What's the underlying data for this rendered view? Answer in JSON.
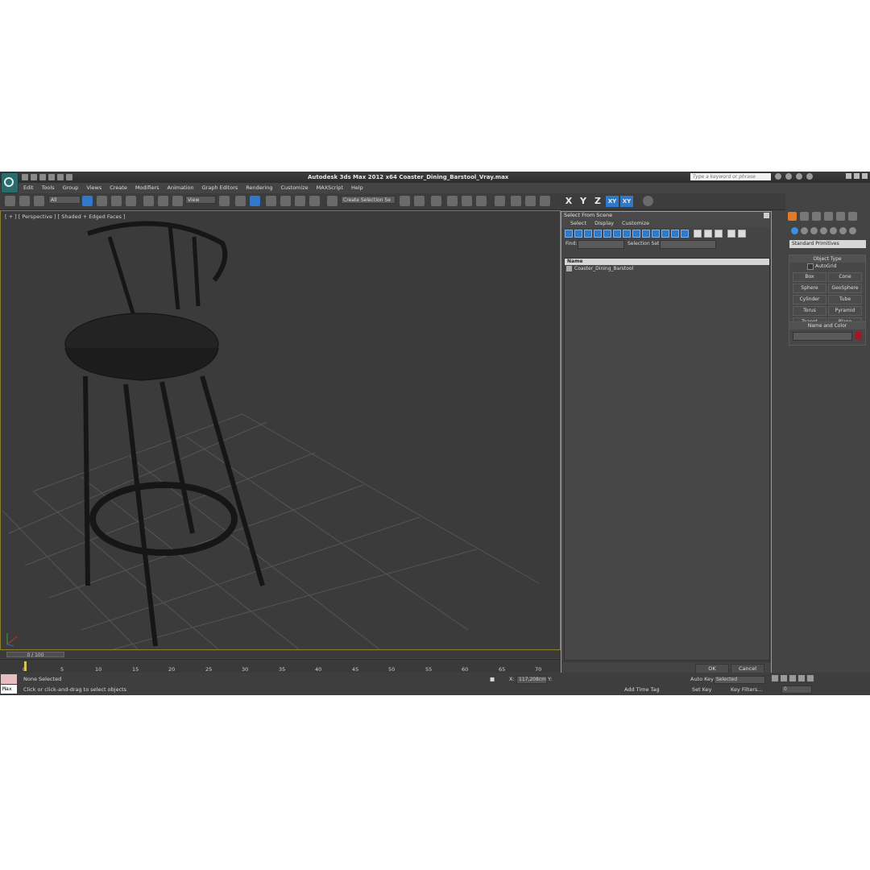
{
  "app": {
    "title": "Autodesk 3ds Max  2012 x64     Coaster_Dining_Barstool_Vray.max",
    "search_placeholder": "Type a keyword or phrase"
  },
  "menu": [
    "Edit",
    "Tools",
    "Group",
    "Views",
    "Create",
    "Modifiers",
    "Animation",
    "Graph Editors",
    "Rendering",
    "Customize",
    "MAXScript",
    "Help"
  ],
  "toolbar": {
    "filter_value": "All",
    "ref_coord_value": "View",
    "selection_set_placeholder": "Create Selection Se",
    "axis_x": "X",
    "axis_y": "Y",
    "axis_z": "Z",
    "axis_xy": "XY",
    "axis_xy2": "XY"
  },
  "viewport": {
    "label": "[ + ] [ Perspective ] [ Shaded + Edged Faces ]"
  },
  "command_panel": {
    "dropdown_value": "Standard Primitives",
    "object_type_title": "Object Type",
    "autogrid_label": "AutoGrid",
    "primitives": [
      "Box",
      "Cone",
      "Sphere",
      "GeoSphere",
      "Cylinder",
      "Tube",
      "Torus",
      "Pyramid",
      "Teapot",
      "Plane"
    ],
    "name_color_title": "Name and Color",
    "object_color": "#a01828"
  },
  "dialog": {
    "title": "Select From Scene",
    "menu": [
      "Select",
      "Display",
      "Customize"
    ],
    "find_label": "Find:",
    "selection_set_label": "Selection Set:",
    "column_name": "Name",
    "items": [
      "Coaster_Dining_Barstool"
    ],
    "ok_label": "OK",
    "cancel_label": "Cancel"
  },
  "timeline": {
    "frame_display": "0 / 100",
    "ticks": [
      "0",
      "5",
      "10",
      "15",
      "20",
      "25",
      "30",
      "35",
      "40",
      "45",
      "50",
      "55",
      "60",
      "65",
      "70"
    ]
  },
  "status": {
    "maxscript_label": "Max",
    "selection_status": "None Selected",
    "prompt": "Click or click-and-drag to select objects",
    "x_label": "X:",
    "x_value": "117,208cm",
    "y_label": "Y:",
    "auto_key_label": "Auto Key",
    "selected_value": "Selected",
    "set_key_label": "Set Key",
    "key_filters_label": "Key Filters...",
    "add_time_tag": "Add Time Tag",
    "frame_value": "0"
  }
}
